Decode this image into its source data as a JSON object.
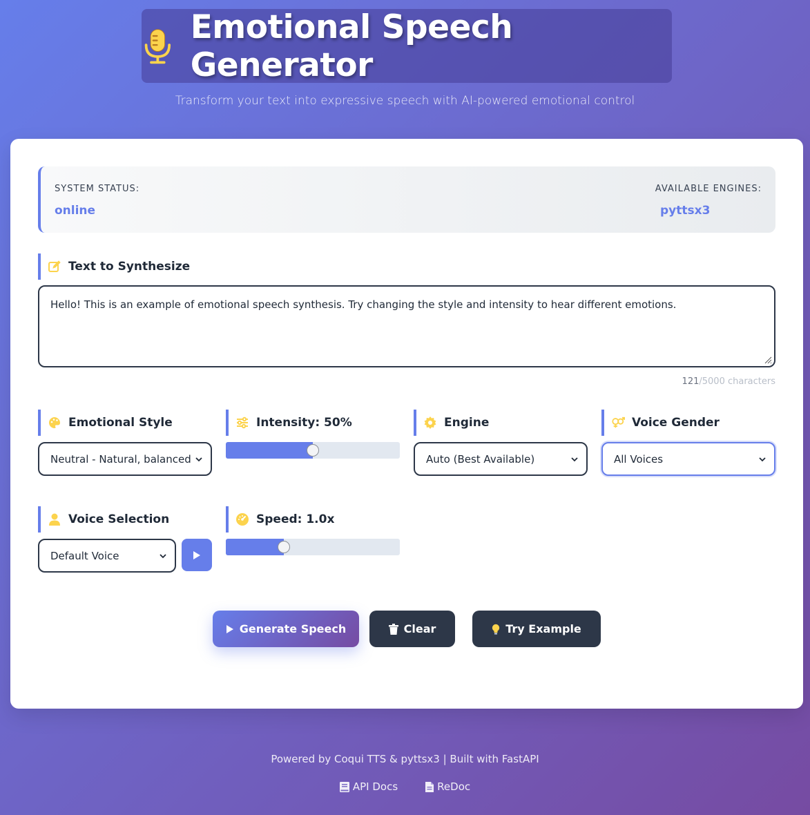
{
  "header": {
    "title": "Emotional Speech Generator",
    "subtitle": "Transform your text into expressive speech with AI-powered emotional control"
  },
  "status": {
    "system_label": "SYSTEM STATUS:",
    "system_value": "online",
    "engines_label": "AVAILABLE ENGINES:",
    "engines_value": "pyttsx3"
  },
  "text_section": {
    "label": "Text to Synthesize",
    "value": "Hello! This is an example of emotional speech synthesis. Try changing the style and intensity to hear different emotions.",
    "char_count": "121",
    "char_max": "/5000 characters"
  },
  "controls": {
    "style": {
      "label": "Emotional Style",
      "selected": "Neutral - Natural, balanced"
    },
    "intensity": {
      "label": "Intensity: 50%",
      "value_percent": 50
    },
    "engine": {
      "label": "Engine",
      "selected": "Auto (Best Available)"
    },
    "gender": {
      "label": "Voice Gender",
      "selected": "All Voices"
    },
    "voice": {
      "label": "Voice Selection",
      "selected": "Default Voice"
    },
    "speed": {
      "label": "Speed: 1.0x",
      "value": 1.0,
      "min": 0.5,
      "max": 2.0
    }
  },
  "buttons": {
    "generate": "Generate Speech",
    "clear": "Clear",
    "example": "Try Example"
  },
  "footer": {
    "credits": "Powered by Coqui TTS & pyttsx3 | Built with FastAPI",
    "api_docs": "API Docs",
    "redoc": "ReDoc"
  },
  "colors": {
    "accent": "#667eea",
    "gradient_end": "#764ba2",
    "dark_button": "#2d3748",
    "icon_yellow": "#fcd34d"
  }
}
